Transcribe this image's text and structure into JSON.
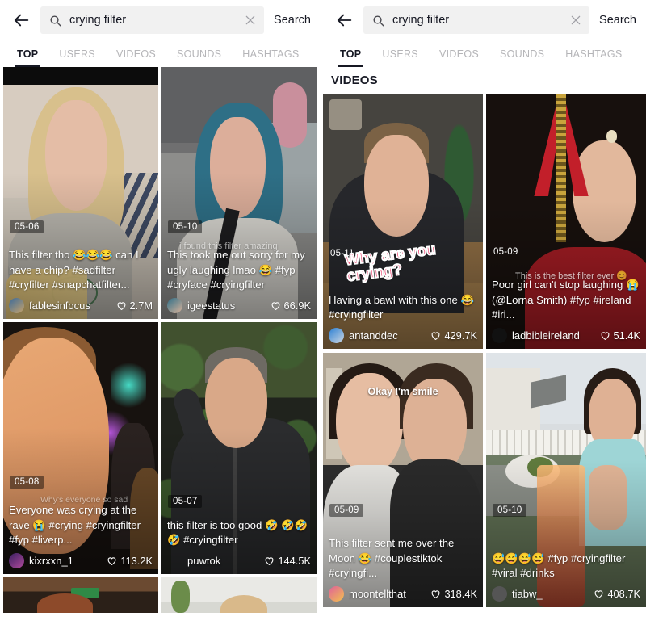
{
  "panels": [
    {
      "id": "left",
      "topbar": {
        "back_icon": "back-arrow-icon",
        "search_icon": "search-icon",
        "search_value": "crying filter",
        "search_placeholder": "Search",
        "clear_icon": "close-icon",
        "search_button": "Search"
      },
      "tabs": [
        {
          "label": "TOP",
          "active": true
        },
        {
          "label": "USERS",
          "active": false
        },
        {
          "label": "VIDEOS",
          "active": false
        },
        {
          "label": "SOUNDS",
          "active": false
        },
        {
          "label": "HASHTAGS",
          "active": false
        }
      ],
      "section_label": "",
      "cards": [
        {
          "date": "05-06",
          "caption": "This filter tho 😂😂😂 can I have a chip? #sadfilter #cryfilter #snapchatfilter...",
          "username": "fablesinfocus",
          "likes": "2.7M",
          "sticker": ""
        },
        {
          "date": "05-10",
          "caption": "This took me out sorry for my ugly laughing lmao 😂 #fyp #cryface #cryingfilter",
          "username": "igeestatus",
          "likes": "66.9K",
          "sticker": "i found this filter amazing"
        },
        {
          "date": "05-08",
          "caption": "Everyone was crying at the rave 😭 #crying #cryingfilter #fyp #liverp...",
          "username": "kixrxxn_1",
          "likes": "113.2K",
          "sticker": "Why's everyone so sad"
        },
        {
          "date": "05-07",
          "caption": "this filter is too good 🤣 🤣🤣🤣 #cryingfilter",
          "username": "puwtok",
          "likes": "144.5K",
          "sticker": ""
        }
      ]
    },
    {
      "id": "right",
      "topbar": {
        "back_icon": "back-arrow-icon",
        "search_icon": "search-icon",
        "search_value": "crying filter",
        "search_placeholder": "Search",
        "clear_icon": "close-icon",
        "search_button": "Search"
      },
      "tabs": [
        {
          "label": "TOP",
          "active": true
        },
        {
          "label": "USERS",
          "active": false
        },
        {
          "label": "VIDEOS",
          "active": false
        },
        {
          "label": "SOUNDS",
          "active": false
        },
        {
          "label": "HASHTAGS",
          "active": false
        }
      ],
      "section_label": "VIDEOS",
      "cards": [
        {
          "date": "05-11",
          "caption": "Having a bawl with this one 😂 #cryingfilter",
          "username": "antanddec",
          "likes": "429.7K",
          "sticker": "Why are you crying?"
        },
        {
          "date": "05-09",
          "caption": "Poor girl can't stop laughing 😭 (@Lorna Smith) #fyp #ireland #iri...",
          "username": "ladbibleireland",
          "likes": "51.4K",
          "sticker": "This is the best filter ever 😊"
        },
        {
          "date": "05-09",
          "caption": "This filter sent me over the Moon 😂 #couplestiktok #cryingfi...",
          "username": "moontellthat",
          "likes": "318.4K",
          "sticker": "Okay I'm smile"
        },
        {
          "date": "05-10",
          "caption": "😅😅😅😅 #fyp #cryingfilter #viral #drinks",
          "username": "tiabw_",
          "likes": "408.7K",
          "sticker": ""
        }
      ]
    }
  ],
  "colors": {
    "text_primary": "#161823",
    "tab_inactive": "#b5b5b8",
    "search_bg": "#f1f1f1",
    "overlay_text": "#ffffff"
  }
}
